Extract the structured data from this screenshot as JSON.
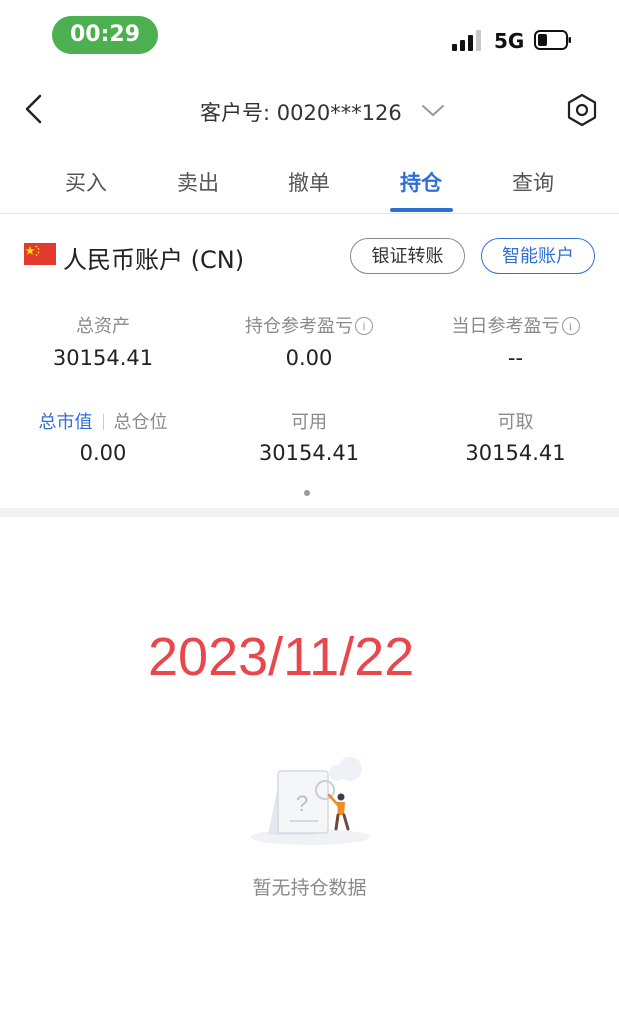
{
  "status_bar": {
    "time": "00:29",
    "network": "5G",
    "icons": [
      "signal-icon",
      "battery-icon"
    ]
  },
  "header": {
    "account_label": "客户号: 0020***126",
    "icons": [
      "back-icon",
      "chevron-down-icon",
      "settings-icon"
    ]
  },
  "tabs": [
    {
      "label": "买入",
      "active": false
    },
    {
      "label": "卖出",
      "active": false
    },
    {
      "label": "撤单",
      "active": false
    },
    {
      "label": "持仓",
      "active": true
    },
    {
      "label": "查询",
      "active": false
    }
  ],
  "account": {
    "title": "人民币账户 (CN)",
    "flag_icon": "china-flag-icon",
    "bank_transfer_button": "银证转账",
    "smart_account_button": "智能账户"
  },
  "metrics_row1": [
    {
      "label": "总资产",
      "value": "30154.41"
    },
    {
      "label": "持仓参考盈亏",
      "value": "0.00",
      "info_icon": "i"
    },
    {
      "label": "当日参考盈亏",
      "value": "--",
      "info_icon": "i"
    }
  ],
  "metrics_row2": {
    "market_value_toggle": "总市值",
    "total_position_toggle": "总仓位",
    "col1_value": "0.00",
    "col2_label": "可用",
    "col2_value": "30154.41",
    "col3_label": "可取",
    "col3_value": "30154.41"
  },
  "overlay_date": "2023/11/22",
  "empty_state": {
    "text": "暂无持仓数据",
    "icon": "empty-document-illustration"
  },
  "colors": {
    "accent_blue": "#2f6fd6",
    "time_pill_green": "#4caf50",
    "overlay_red": "#e8474c"
  }
}
